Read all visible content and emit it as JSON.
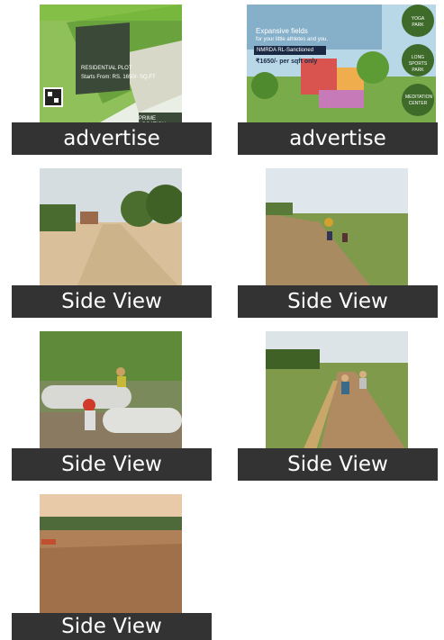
{
  "gallery": {
    "items": [
      {
        "caption": "advertise",
        "image": "plot-advertisement-aerial",
        "overlay": [
          "RESIDENTIAL PLOT",
          "Starts From: RS. 1650/- SQ.FT",
          "PRIME LOCATION"
        ]
      },
      {
        "caption": "advertise",
        "image": "park-advertisement",
        "overlay": [
          "Expansive fields",
          "for your little athletes and you.",
          "NMRDA RL-Sanctioned",
          "₹1650/- per sqft only",
          "YOGA PARK",
          "LONG SPORTS PARK",
          "MEDITATION CENTER"
        ]
      },
      {
        "caption": "Side View",
        "image": "dirt-road-trees"
      },
      {
        "caption": "Side View",
        "image": "site-workers-road"
      },
      {
        "caption": "Side View",
        "image": "drainage-pipes-worker"
      },
      {
        "caption": "Side View",
        "image": "trench-workers"
      },
      {
        "caption": "Side View",
        "image": "leveled-ground"
      }
    ]
  },
  "colors": {
    "caption_bg": "#333333",
    "caption_text": "#ffffff"
  }
}
